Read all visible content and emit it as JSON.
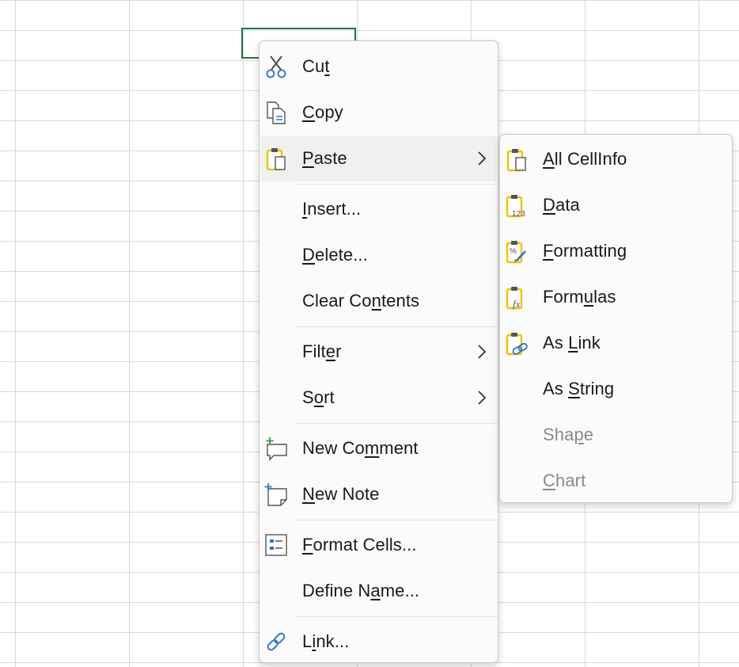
{
  "context_menu": {
    "items": [
      {
        "pre": "Cu",
        "acc": "t",
        "post": "",
        "icon": "scissors-icon",
        "submenu": false
      },
      {
        "pre": "",
        "acc": "C",
        "post": "opy",
        "icon": "copy-icon",
        "submenu": false
      },
      {
        "pre": "",
        "acc": "P",
        "post": "aste",
        "icon": "paste-icon",
        "submenu": true
      },
      {
        "pre": "",
        "acc": "I",
        "post": "nsert...",
        "icon": "",
        "submenu": false
      },
      {
        "pre": "",
        "acc": "D",
        "post": "elete...",
        "icon": "",
        "submenu": false
      },
      {
        "pre": "Clear Co",
        "acc": "n",
        "post": "tents",
        "icon": "",
        "submenu": false
      },
      {
        "pre": "Filt",
        "acc": "e",
        "post": "r",
        "icon": "",
        "submenu": true
      },
      {
        "pre": "S",
        "acc": "o",
        "post": "rt",
        "icon": "",
        "submenu": true
      },
      {
        "pre": "New Co",
        "acc": "m",
        "post": "ment",
        "icon": "new-comment-icon",
        "submenu": false
      },
      {
        "pre": "",
        "acc": "N",
        "post": "ew Note",
        "icon": "new-note-icon",
        "submenu": false
      },
      {
        "pre": "",
        "acc": "F",
        "post": "ormat Cells...",
        "icon": "format-cells-icon",
        "submenu": false
      },
      {
        "pre": "Define N",
        "acc": "a",
        "post": "me...",
        "icon": "",
        "submenu": false
      },
      {
        "pre": "L",
        "acc": "i",
        "post": "nk...",
        "icon": "link-icon",
        "submenu": false
      }
    ]
  },
  "paste_submenu": {
    "items": [
      {
        "pre": "",
        "acc": "A",
        "post": "ll CellInfo",
        "icon": "paste-all-icon",
        "disabled": false
      },
      {
        "pre": "",
        "acc": "D",
        "post": "ata",
        "icon": "paste-data-icon",
        "disabled": false
      },
      {
        "pre": "",
        "acc": "F",
        "post": "ormatting",
        "icon": "paste-formatting-icon",
        "disabled": false
      },
      {
        "pre": "Form",
        "acc": "u",
        "post": "las",
        "icon": "paste-formulas-icon",
        "disabled": false
      },
      {
        "pre": "As ",
        "acc": "L",
        "post": "ink",
        "icon": "paste-link-icon",
        "disabled": false
      },
      {
        "pre": "As ",
        "acc": "S",
        "post": "tring",
        "icon": "",
        "disabled": false
      },
      {
        "pre": "Sha",
        "acc": "p",
        "post": "e",
        "icon": "",
        "disabled": true
      },
      {
        "pre": "",
        "acc": "C",
        "post": "hart",
        "icon": "",
        "disabled": true
      }
    ]
  },
  "colors": {
    "active_cell_border": "#217346",
    "clipboard_yellow": "#f2c200",
    "icon_blue": "#2b78c5",
    "comment_green": "#2e9e4a"
  }
}
